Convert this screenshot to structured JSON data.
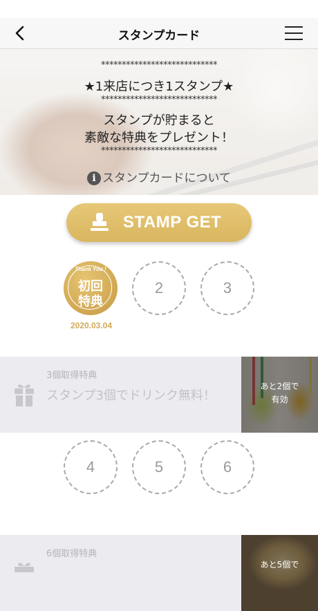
{
  "nav": {
    "title": "スタンプカード"
  },
  "hero": {
    "stars_line": "****************************",
    "headline": "★1来店につき1スタンプ★",
    "line1": "スタンプが貯まると",
    "line2": "素敵な特典をプレゼント！",
    "info_icon": "i",
    "info_label": "スタンプカードについて"
  },
  "stamp_button": {
    "label": "STAMP GET",
    "icon": "stamp-icon"
  },
  "stamps": {
    "first": {
      "thank_you": "Thank You !",
      "line1": "初回",
      "line2": "特典",
      "date": "2020.03.04"
    },
    "slots": [
      "2",
      "3",
      "4",
      "5",
      "6"
    ]
  },
  "benefits": [
    {
      "subtitle": "3個取得特典",
      "text": "スタンプ3個でドリンク無料！",
      "note_line1": "あと2個で",
      "note_line2": "有効"
    },
    {
      "subtitle": "6個取得特典",
      "note_line1": "あと5個で"
    }
  ],
  "colors": {
    "gold": "#d9b65f",
    "date_gold": "#d2aa5a",
    "benefit_bg": "#ececf0"
  }
}
